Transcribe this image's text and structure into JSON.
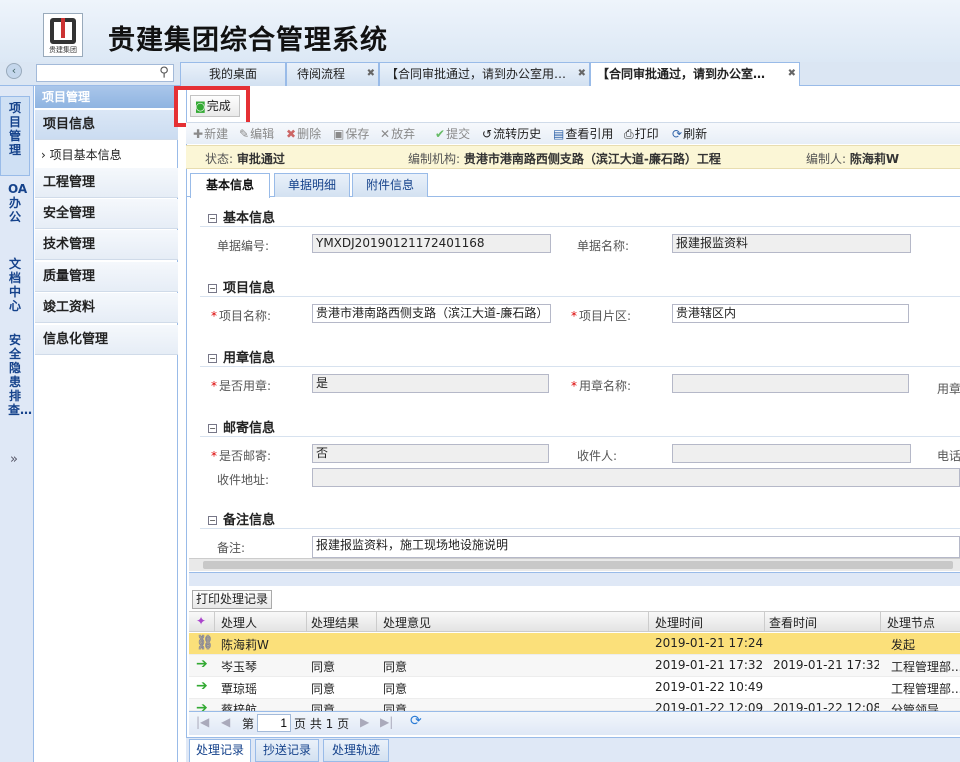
{
  "header": {
    "logo_text": "贵建集团",
    "title": "贵建集团综合管理系统"
  },
  "tabs": [
    {
      "label": "我的桌面"
    },
    {
      "label": "待阅流程"
    },
    {
      "label": "【合同审批通过，请到办公室用…"
    },
    {
      "label": "【合同审批通过，请到办公室…"
    }
  ],
  "vertical_nav": [
    {
      "label": "项目管理"
    },
    {
      "label": "OA办公"
    },
    {
      "label": "文档中心"
    },
    {
      "label": "安全隐患排查…"
    }
  ],
  "sidebar": {
    "header": "项目管理",
    "items": [
      {
        "label": "项目信息"
      },
      {
        "label": "项目基本信息"
      },
      {
        "label": "工程管理"
      },
      {
        "label": "安全管理"
      },
      {
        "label": "技术管理"
      },
      {
        "label": "质量管理"
      },
      {
        "label": "竣工资料"
      },
      {
        "label": "信息化管理"
      }
    ]
  },
  "actions": {
    "done": "完成"
  },
  "toolbar": {
    "new": "新建",
    "edit": "编辑",
    "delete": "删除",
    "save": "保存",
    "abandon": "放弃",
    "submit": "提交",
    "history": "流转历史",
    "refs": "查看引用",
    "print": "打印",
    "refresh": "刷新"
  },
  "status": {
    "state_label": "状态:",
    "state_value": "审批通过",
    "org_label": "编制机构:",
    "org_value": "贵港市港南路西侧支路（滨江大道-廉石路）工程",
    "author_label": "编制人:",
    "author_value": "陈海莉W"
  },
  "sub_tabs": [
    "基本信息",
    "单据明细",
    "附件信息"
  ],
  "form": {
    "basic": {
      "title": "基本信息",
      "doc_no_label": "单据编号:",
      "doc_no": "YMXDJ20190121172401168",
      "doc_name_label": "单据名称:",
      "doc_name": "报建报监资料"
    },
    "project": {
      "title": "项目信息",
      "name_label": "项目名称:",
      "name": "贵港市港南路西侧支路（滨江大道-廉石路）",
      "area_label": "项目片区:",
      "area": "贵港辖区内"
    },
    "seal": {
      "title": "用章信息",
      "use_label": "是否用章:",
      "use": "是",
      "seal_name_label": "用章名称:",
      "seal_name": "",
      "extra_label": "用章"
    },
    "mail": {
      "title": "邮寄信息",
      "mail_label": "是否邮寄:",
      "mail": "否",
      "recipient_label": "收件人:",
      "recipient": "",
      "phone_label": "电话",
      "address_label": "收件地址:",
      "address": ""
    },
    "remark": {
      "title": "备注信息",
      "label": "备注:",
      "value": "报建报监资料，施工现场地设施说明"
    }
  },
  "records": {
    "print_button": "打印处理记录",
    "columns": [
      "处理人",
      "处理结果",
      "处理意见",
      "处理时间",
      "查看时间",
      "处理节点"
    ],
    "rows": [
      {
        "person": "陈海莉W",
        "result": "",
        "opinion": "",
        "time": "2019-01-21 17:24...",
        "viewed": "",
        "node": "发起"
      },
      {
        "person": "岑玉琴",
        "result": "同意",
        "opinion": "同意",
        "time": "2019-01-21 17:32...",
        "viewed": "2019-01-21 17:32...",
        "node": "工程管理部..."
      },
      {
        "person": "覃琼瑶",
        "result": "同意",
        "opinion": "同意",
        "time": "2019-01-22 10:49...",
        "viewed": "",
        "node": "工程管理部..."
      },
      {
        "person": "蔡梓航",
        "result": "同意",
        "opinion": "同意",
        "time": "2019-01-22 12:09...",
        "viewed": "2019-01-22 12:08...",
        "node": "分管领导..."
      }
    ]
  },
  "pager": {
    "prefix": "第",
    "page": "1",
    "suffix": "页 共 1 页"
  },
  "bottom_tabs": [
    "处理记录",
    "抄送记录",
    "处理轨迹"
  ]
}
